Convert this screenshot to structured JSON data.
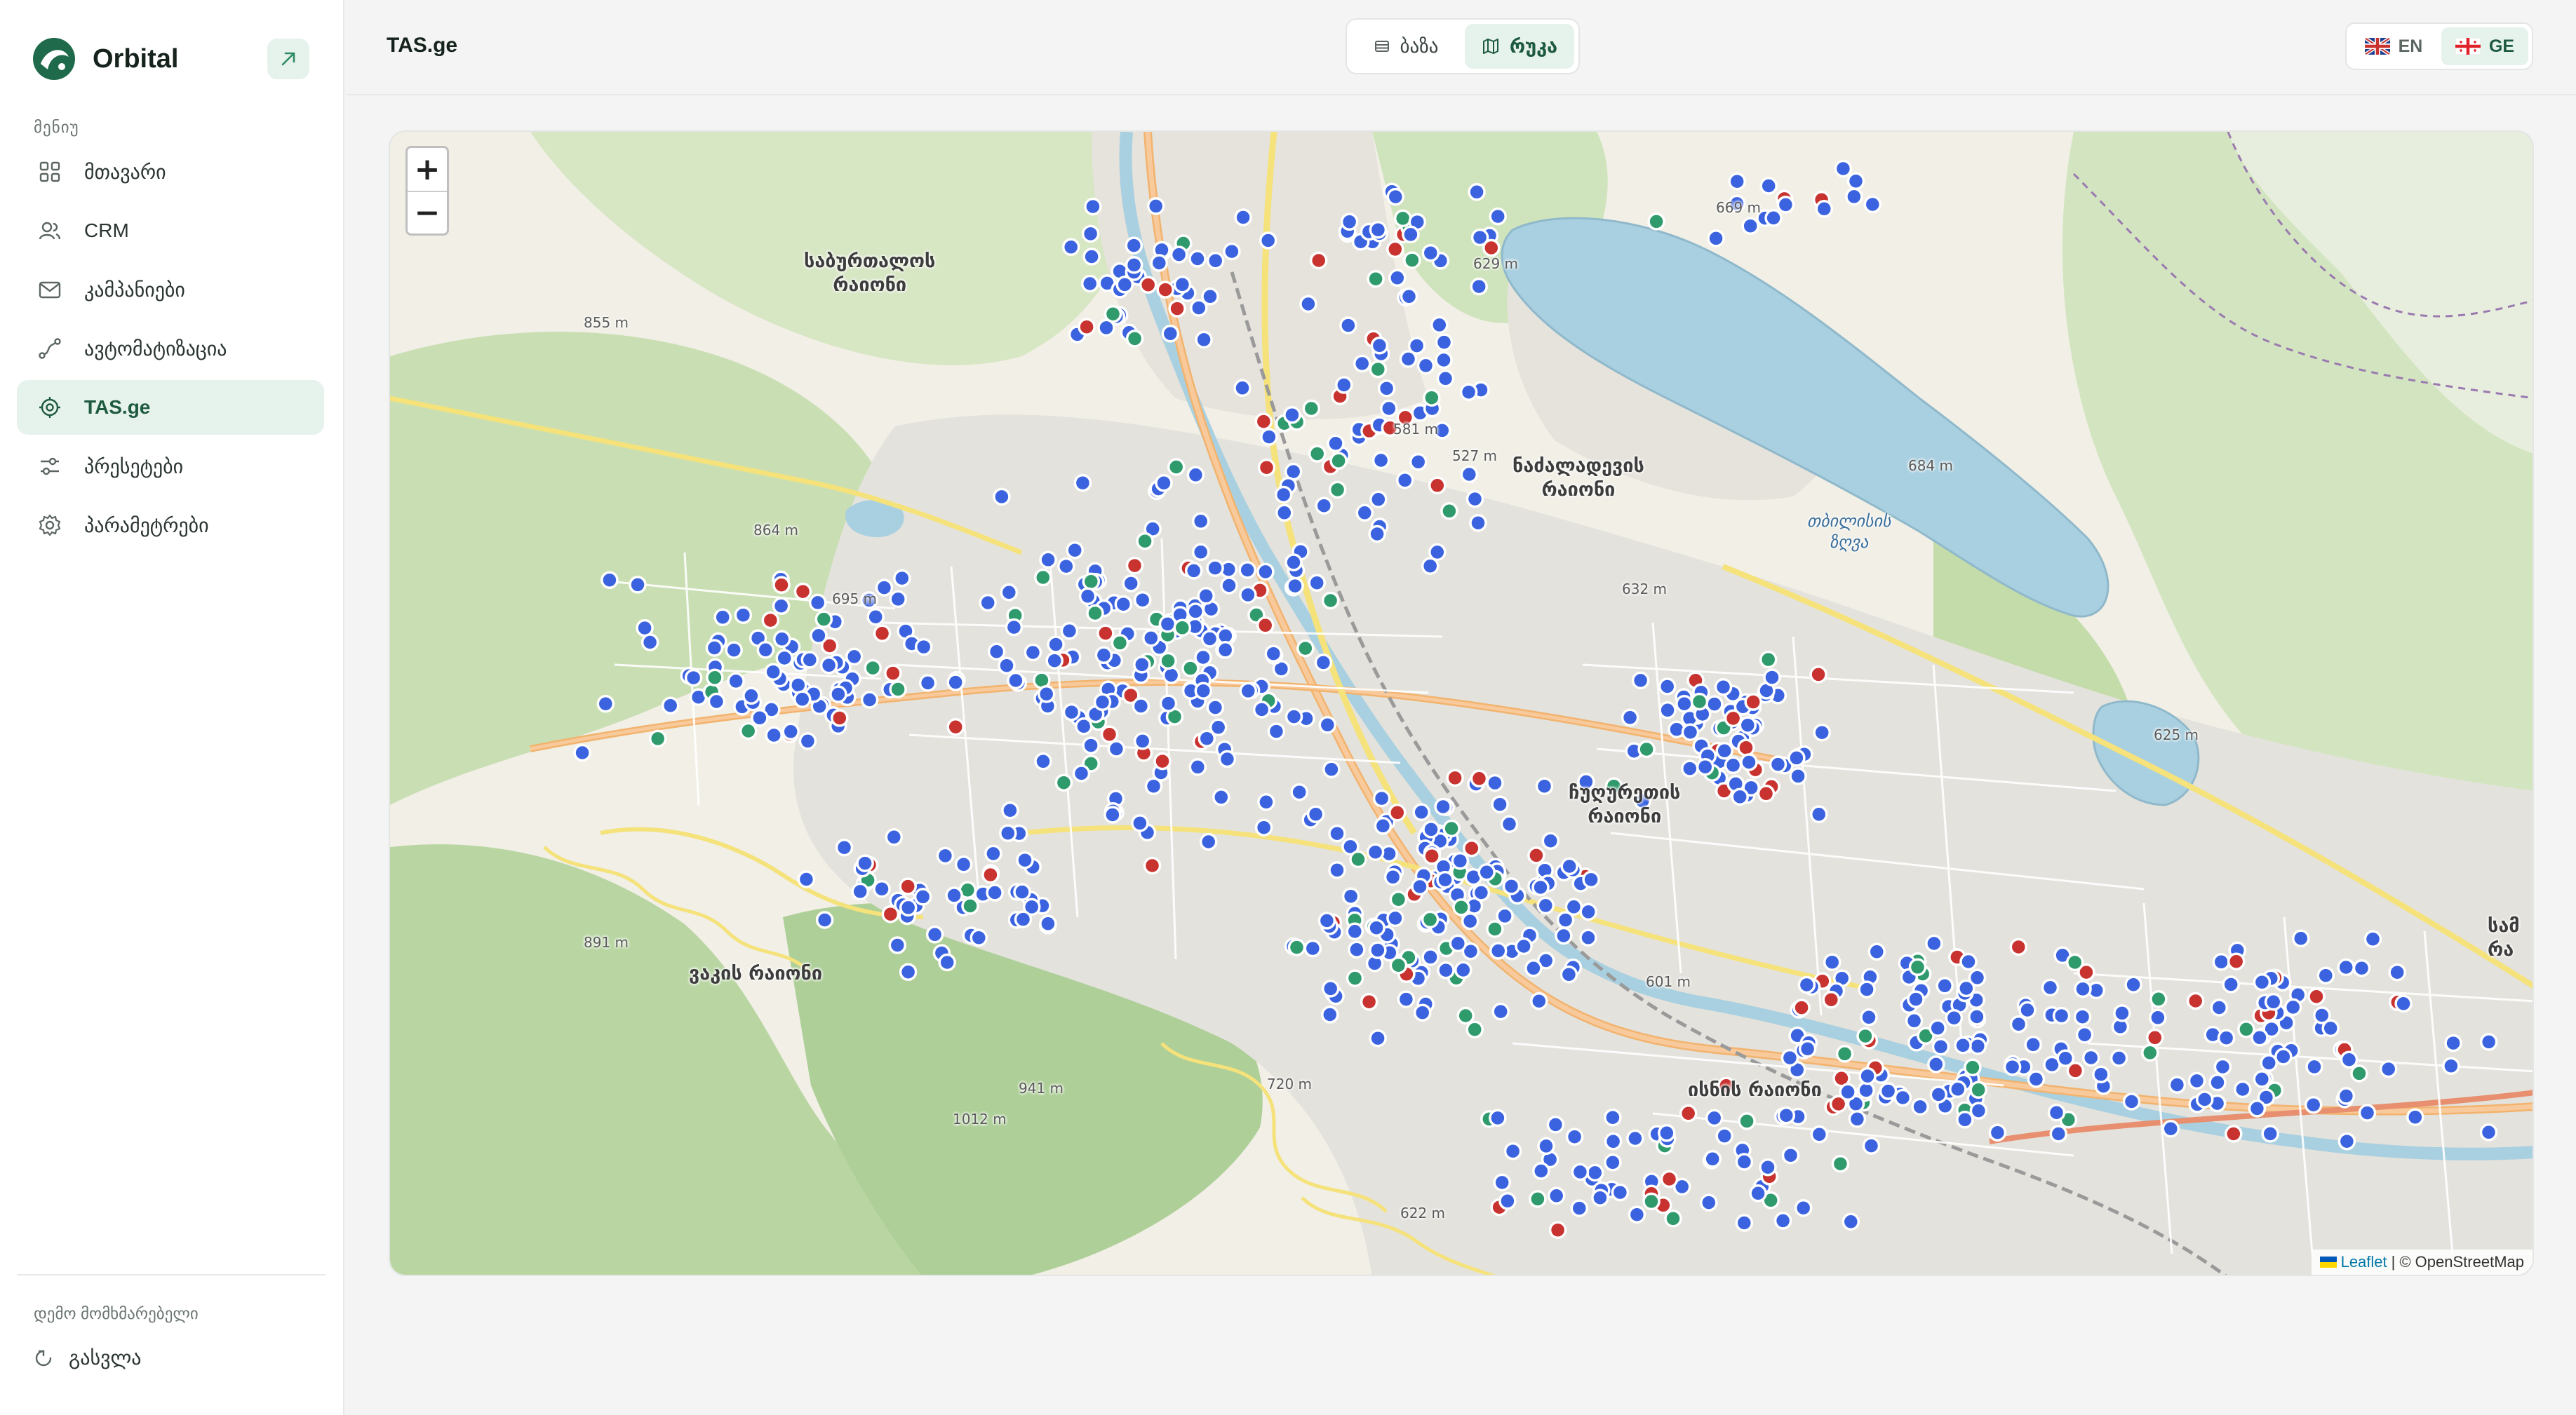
{
  "brand": {
    "name": "Orbital"
  },
  "sidebar": {
    "menu_label": "მენიუ",
    "items": [
      {
        "label": "მთავარი",
        "icon": "grid-icon"
      },
      {
        "label": "CRM",
        "icon": "users-icon"
      },
      {
        "label": "კამპანიები",
        "icon": "mail-icon"
      },
      {
        "label": "ავტომატიზაცია",
        "icon": "workflow-icon"
      },
      {
        "label": "TAS.ge",
        "icon": "target-icon",
        "active": true
      },
      {
        "label": "პრესეტები",
        "icon": "sliders-icon"
      },
      {
        "label": "პარამეტრები",
        "icon": "gear-icon"
      }
    ],
    "user_label": "დემო მომხმარებელი",
    "logout_label": "გასვლა"
  },
  "header": {
    "title": "TAS.ge",
    "view_toggle": {
      "list_label": "ბაზა",
      "map_label": "რუკა",
      "active": "map"
    },
    "lang": {
      "en_label": "EN",
      "ge_label": "GE",
      "active": "GE"
    }
  },
  "map": {
    "zoom_in": "+",
    "zoom_out": "−",
    "attribution_leaflet": "Leaflet",
    "attribution_sep": "|",
    "attribution_osm": "© OpenStreetMap",
    "marker_colors": {
      "blue": "#3b63e0",
      "green": "#2f9a6c",
      "red": "#c8322f"
    },
    "labels": {
      "saburtalo": "საბურთალოს\nრაიონი",
      "nadzaladevi": "ნაძალადევის\nრაიონი",
      "chughureti": "ჩუღურეთის\nრაიონი",
      "vake": "ვაკის რაიონი",
      "samgori": "სამ\nრა",
      "lake": "თბილისის\nზღვა",
      "isani": "ისნის რაიონი",
      "m855": "855 m",
      "m629": "629 m",
      "m581": "581 m",
      "m527": "527 m",
      "m864": "864 m",
      "m695": "695 m",
      "m632": "632 m",
      "m684": "684 m",
      "m625": "625 m",
      "m891": "891 m",
      "m941": "941 m",
      "m1012": "1012 m",
      "m720": "720 m",
      "m622": "622 m",
      "m601": "601 m",
      "m669": "669 m"
    }
  }
}
